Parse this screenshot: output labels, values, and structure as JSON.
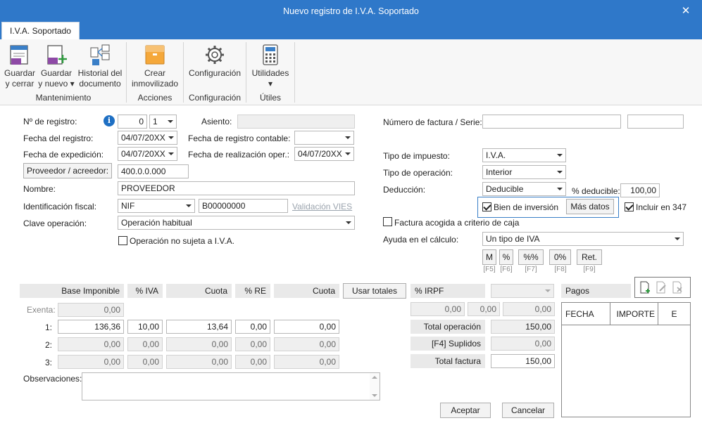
{
  "window": {
    "title": "Nuevo registro de I.V.A. Soportado",
    "close_glyph": "✕"
  },
  "ribbon": {
    "tab": "I.V.A. Soportado",
    "buttons": {
      "guardar_cerrar": [
        "Guardar",
        "y cerrar"
      ],
      "guardar_nuevo": [
        "Guardar",
        "y nuevo ▾"
      ],
      "historial": [
        "Historial del",
        "documento"
      ],
      "crear_inmovilizado": [
        "Crear",
        "inmovilizado"
      ],
      "configuracion": [
        "Configuración",
        ""
      ],
      "utilidades": [
        "Utilidades",
        "▾"
      ]
    },
    "groups": {
      "mantenimiento": "Mantenimiento",
      "acciones": "Acciones",
      "configuracion": "Configuración",
      "utiles": "Útiles"
    }
  },
  "form": {
    "num_registro_label": "Nº de registro:",
    "num_registro_value": "0",
    "num_registro_serie": "1",
    "asiento_label": "Asiento:",
    "asiento_value": "",
    "fecha_registro_label": "Fecha del registro:",
    "fecha_registro_value": "04/07/20XX",
    "fecha_contable_label": "Fecha de registro contable:",
    "fecha_contable_value": "",
    "fecha_expedicion_label": "Fecha de expedición:",
    "fecha_expedicion_value": "04/07/20XX",
    "fecha_realizacion_label": "Fecha de realización oper.:",
    "fecha_realizacion_value": "04/07/20XX",
    "proveedor_button": "Proveedor / acreedor:",
    "proveedor_value": "400.0.0.000",
    "nombre_label": "Nombre:",
    "nombre_value": "PROVEEDOR",
    "id_fiscal_label": "Identificación fiscal:",
    "id_fiscal_tipo": "NIF",
    "id_fiscal_value": "B00000000",
    "validacion_vies": "Validación VIES",
    "clave_label": "Clave operación:",
    "clave_value": "Operación habitual",
    "no_sujeta_label": "Operación no sujeta a I.V.A.",
    "no_sujeta_checked": false,
    "num_factura_label": "Número de factura / Serie:",
    "num_factura_value": "",
    "serie_value": "",
    "tipo_impuesto_label": "Tipo de impuesto:",
    "tipo_impuesto_value": "I.V.A.",
    "tipo_operacion_label": "Tipo de operación:",
    "tipo_operacion_value": "Interior",
    "deduccion_label": "Deducción:",
    "deduccion_value": "Deducible",
    "pct_deducible_label": "% deducible:",
    "pct_deducible_value": "100,00",
    "bien_inversion_label": "Bien de inversión",
    "bien_inversion_checked": true,
    "mas_datos": "Más datos",
    "incluir_347_label": "Incluir en 347",
    "incluir_347_checked": true,
    "criterio_caja_label": "Factura acogida a criterio de caja",
    "criterio_caja_checked": false,
    "ayuda_label": "Ayuda en el cálculo:",
    "ayuda_value": "Un tipo de IVA",
    "calc_buttons": [
      {
        "label": "M",
        "key": "[F5]"
      },
      {
        "label": "%",
        "key": "[F6]"
      },
      {
        "label": "%%",
        "key": "[F7]"
      },
      {
        "label": "0%",
        "key": "[F8]"
      },
      {
        "label": "Ret.",
        "key": "[F9]"
      }
    ]
  },
  "table": {
    "headers": {
      "base": "Base Imponible",
      "iva": "% IVA",
      "cuota": "Cuota",
      "re": "% RE",
      "cuota_re": "Cuota"
    },
    "usar_totales": "Usar totales",
    "exenta_label": "Exenta:",
    "exenta_value": "0,00",
    "rows": [
      {
        "label": "1:",
        "base": "136,36",
        "iva": "10,00",
        "cuota": "13,64",
        "re": "0,00",
        "cuota_re": "0,00"
      },
      {
        "label": "2:",
        "base": "0,00",
        "iva": "0,00",
        "cuota": "0,00",
        "re": "0,00",
        "cuota_re": "0,00"
      },
      {
        "label": "3:",
        "base": "0,00",
        "iva": "0,00",
        "cuota": "0,00",
        "re": "0,00",
        "cuota_re": "0,00"
      }
    ],
    "irpf_label": "% IRPF",
    "irpf_values": [
      "0,00",
      "0,00",
      "0,00"
    ],
    "total_operacion_label": "Total operación",
    "total_operacion_value": "150,00",
    "suplidos_label": "[F4] Suplidos",
    "suplidos_value": "0,00",
    "total_factura_label": "Total factura",
    "total_factura_value": "150,00"
  },
  "observaciones_label": "Observaciones:",
  "observaciones_value": "",
  "pagos": {
    "label": "Pagos",
    "columns": [
      "FECHA",
      "IMPORTE",
      "E"
    ]
  },
  "footer": {
    "aceptar": "Aceptar",
    "cancelar": "Cancelar"
  },
  "colors": {
    "accent": "#2f78c9",
    "link_disabled": "#9aa3ad",
    "info": "#1e6fc3"
  }
}
